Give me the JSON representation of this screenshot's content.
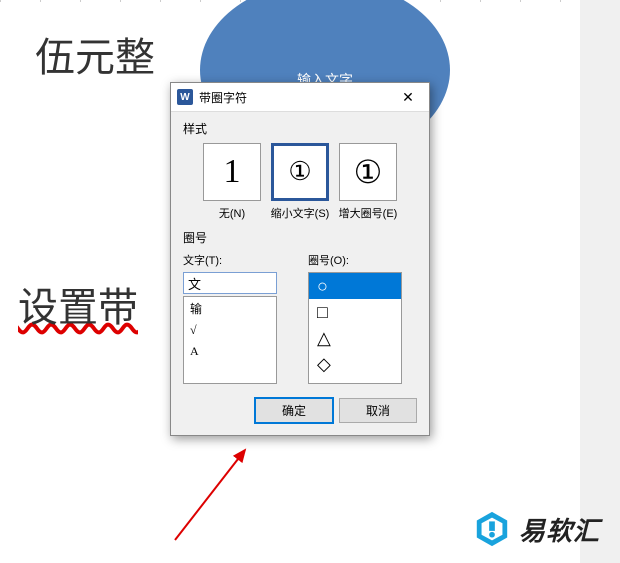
{
  "doc": {
    "text1": "伍元整",
    "text2": "设置带",
    "circle_text": "输入文字"
  },
  "dialog": {
    "title": "带圈字符",
    "icon_letter": "W",
    "style_label": "样式",
    "styles": {
      "none": {
        "glyph": "1",
        "caption": "无(N)"
      },
      "shrink": {
        "glyph": "①",
        "caption": "缩小文字(S)"
      },
      "enlarge": {
        "glyph": "①",
        "caption": "增大圈号(E)"
      }
    },
    "enclose_label": "圈号",
    "text_label": "文字(T):",
    "shape_label": "圈号(O):",
    "text_value": "文",
    "text_options": [
      "输",
      "√",
      "A"
    ],
    "shapes": [
      "○",
      "□",
      "△",
      "◇"
    ],
    "ok": "确定",
    "cancel": "取消"
  },
  "logo": {
    "text": "易软汇"
  }
}
